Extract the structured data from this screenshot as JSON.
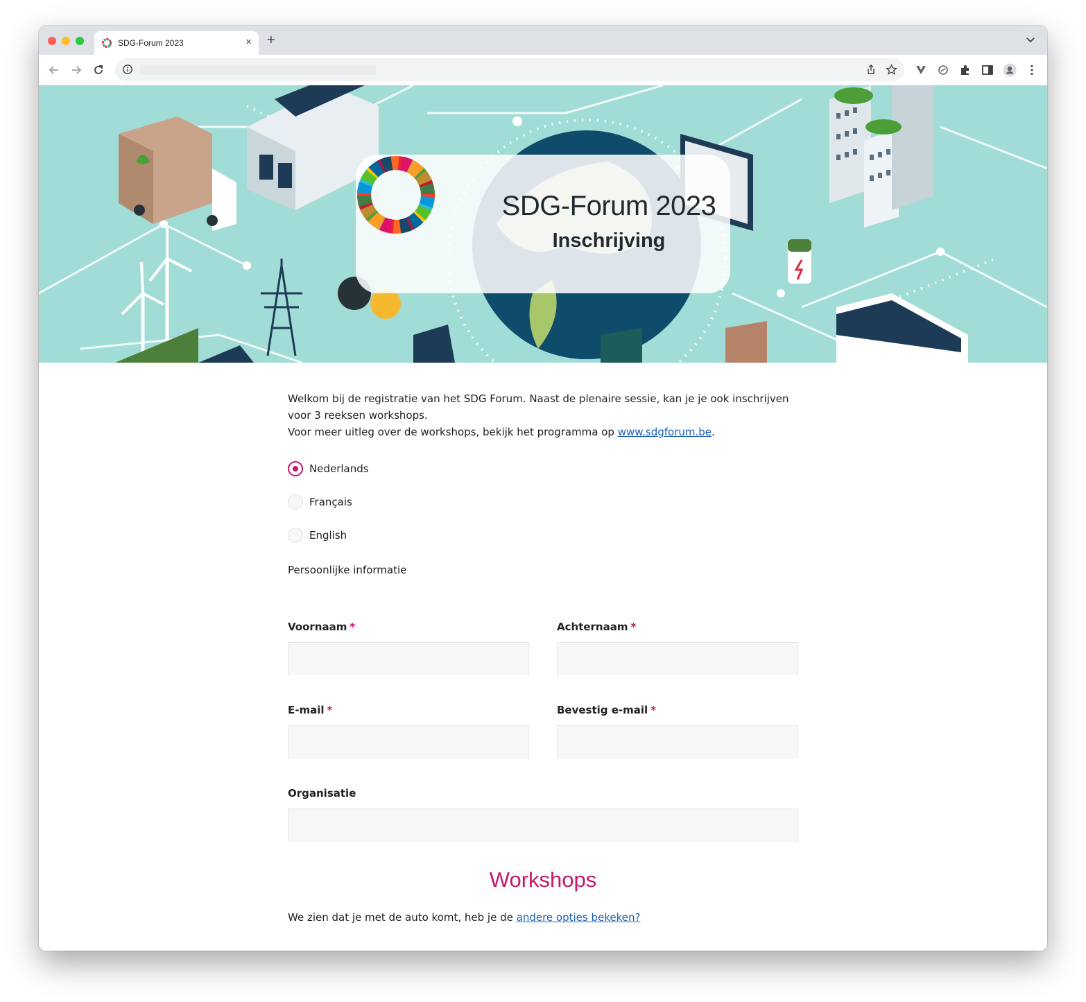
{
  "browser": {
    "tab_title": "SDG-Forum 2023",
    "tab_close": "×",
    "new_tab": "+"
  },
  "hero": {
    "title": "SDG-Forum 2023",
    "subtitle": "Inschrijving"
  },
  "intro": {
    "line1": "Welkom bij de registratie van het SDG Forum. Naast de plenaire sessie, kan je je ook inschrijven voor 3 reeksen workshops.",
    "line2_prefix": "Voor meer uitleg over de workshops, bekijk het programma op ",
    "link": "www.sdgforum.be",
    "line2_suffix": "."
  },
  "languages": [
    {
      "label": "Nederlands",
      "checked": true
    },
    {
      "label": "Français",
      "checked": false
    },
    {
      "label": "English",
      "checked": false
    }
  ],
  "personal_section": "Persoonlijke informatie",
  "fields": {
    "first_name": "Voornaam",
    "last_name": "Achternaam",
    "email": "E-mail",
    "confirm_email": "Bevestig e-mail",
    "organisation": "Organisatie",
    "required_marker": "*"
  },
  "workshops": {
    "title": "Workshops",
    "note_prefix": "We zien dat je met de auto komt, heb je de ",
    "note_link": "andere opties bekeken?"
  },
  "colors": {
    "accent": "#c4166a",
    "link": "#1a5fb4",
    "banner_bg": "#a2dcd6"
  }
}
